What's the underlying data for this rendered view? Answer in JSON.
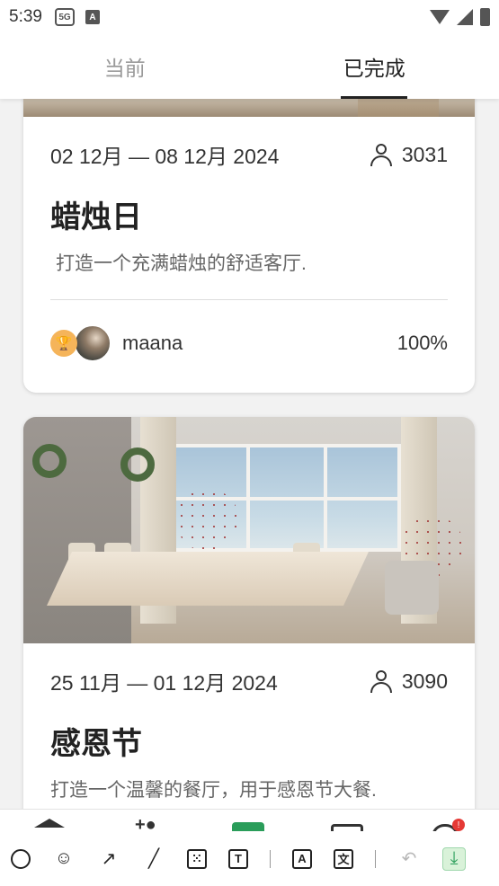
{
  "status_bar": {
    "time": "5:39"
  },
  "tabs": [
    {
      "label": "当前",
      "active": false
    },
    {
      "label": "已完成",
      "active": true
    }
  ],
  "cards": [
    {
      "date_range": "02 12月 — 08 12月 2024",
      "participants": "3031",
      "title": "蜡烛日",
      "description": "打造一个充满蜡烛的舒适客厅.",
      "winner": {
        "username": "maana",
        "percent": "100%"
      }
    },
    {
      "date_range": "25 11月 — 01 12月 2024",
      "participants": "3090",
      "title": "感恩节",
      "description": "打造一个温馨的餐厅，用于感恩节大餐."
    }
  ],
  "toolbar": {
    "tools": [
      "circle-icon",
      "emoji-icon",
      "arrow-icon",
      "pen-icon",
      "dice-icon",
      "text-icon",
      "translate-image-icon",
      "translate-icon",
      "undo-icon",
      "download-icon"
    ],
    "colors": {
      "download_bg": "#d9f2d9",
      "download_fg": "#2a9d5a",
      "badge": "#e53935"
    }
  }
}
